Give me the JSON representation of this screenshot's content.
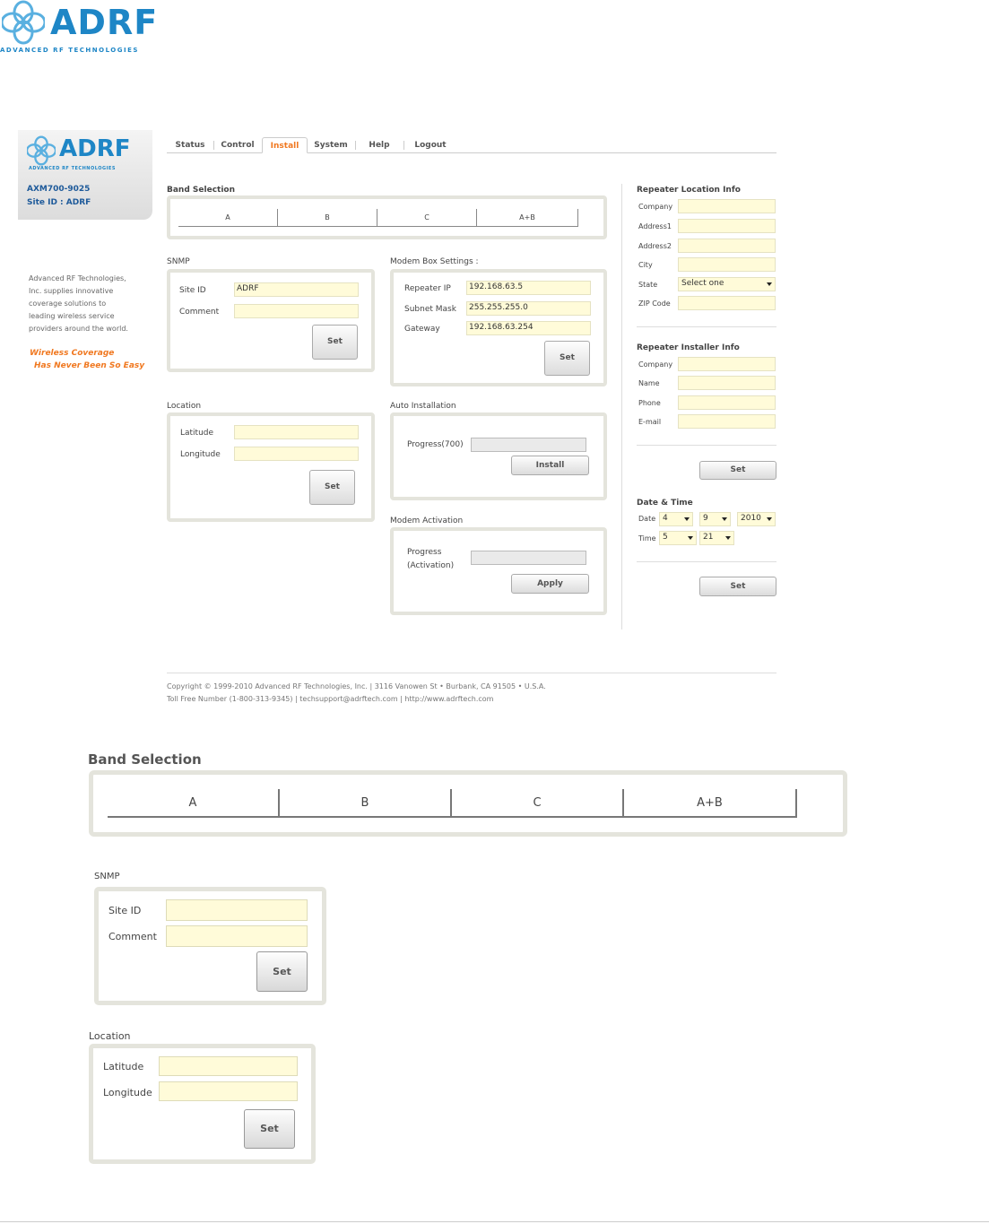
{
  "doc_logo": {
    "word": "ADRF",
    "tagline": "ADVANCED RF TECHNOLOGIES"
  },
  "sidebar": {
    "logo_word": "ADRF",
    "logo_tag": "ADVANCED RF TECHNOLOGIES",
    "model": "AXM700-9025",
    "site_id": "Site ID : ADRF",
    "blurb": "Advanced RF Technologies, Inc. supplies innovative coverage solutions to leading wireless service providers around the world.",
    "slogan_line1": "Wireless Coverage",
    "slogan_line2": "Has Never Been So Easy"
  },
  "nav": {
    "tabs": [
      {
        "label": "Status"
      },
      {
        "label": "Control"
      },
      {
        "label": "Install",
        "active": true
      },
      {
        "label": "System"
      },
      {
        "label": "Help"
      },
      {
        "label": "Logout"
      }
    ]
  },
  "band_selection": {
    "title": "Band Selection",
    "bands": [
      "A",
      "B",
      "C",
      "A+B"
    ]
  },
  "snmp": {
    "title": "SNMP",
    "site_id_label": "Site ID",
    "site_id_value": "ADRF",
    "comment_label": "Comment",
    "comment_value": "",
    "set_label": "Set"
  },
  "location": {
    "title": "Location",
    "latitude_label": "Latitude",
    "latitude_value": "",
    "longitude_label": "Longitude",
    "longitude_value": "",
    "set_label": "Set"
  },
  "modem_box": {
    "title": "Modem Box Settings :",
    "repeater_ip_label": "Repeater IP",
    "repeater_ip_value": "192.168.63.5",
    "subnet_label": "Subnet Mask",
    "subnet_value": "255.255.255.0",
    "gateway_label": "Gateway",
    "gateway_value": "192.168.63.254",
    "set_label": "Set"
  },
  "auto_install": {
    "title": "Auto Installation",
    "progress_label": "Progress(700)",
    "progress": 0,
    "install_label": "Install"
  },
  "modem_activation": {
    "title": "Modem Activation",
    "progress_label_1": "Progress",
    "progress_label_2": "(Activation)",
    "progress": 0,
    "apply_label": "Apply"
  },
  "repeater_location": {
    "title": "Repeater Location Info",
    "fields": [
      "Company",
      "Address1",
      "Address2",
      "City",
      "State",
      "ZIP Code"
    ],
    "state_value": "Select one"
  },
  "repeater_installer": {
    "title": "Repeater Installer Info",
    "fields": [
      "Company",
      "Name",
      "Phone",
      "E-mail"
    ],
    "set_label": "Set"
  },
  "date_time": {
    "title": "Date & Time",
    "date_label": "Date",
    "month": "4",
    "day": "9",
    "year": "2010",
    "time_label": "Time",
    "hour": "5",
    "minute": "21",
    "set_label": "Set"
  },
  "footer": {
    "line1": "Copyright © 1999-2010 Advanced RF Technologies, Inc. | 3116 Vanowen St • Burbank, CA 91505 • U.S.A.",
    "line2": "Toll Free Number (1-800-313-9345) | techsupport@adrftech.com | http://www.adrftech.com"
  }
}
